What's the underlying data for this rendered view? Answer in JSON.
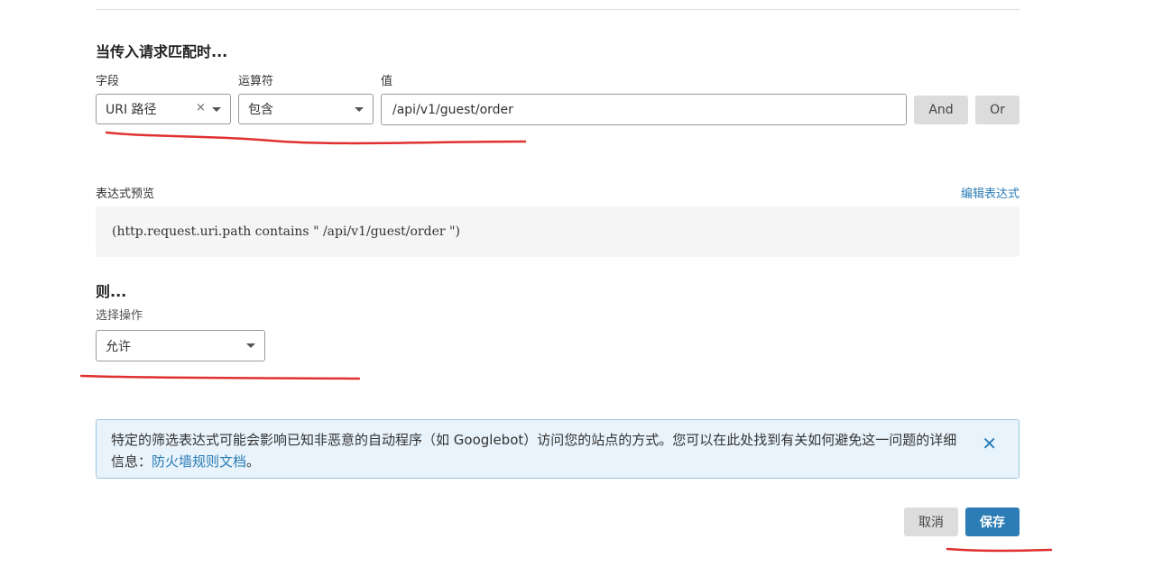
{
  "condition": {
    "heading": "当传入请求匹配时...",
    "field_label": "字段",
    "operator_label": "运算符",
    "value_label": "值",
    "field_value": "URI 路径",
    "clear_glyph": "×",
    "operator_value": "包含",
    "value_input": "/api/v1/guest/order",
    "and_label": "And",
    "or_label": "Or"
  },
  "preview": {
    "label": "表达式预览",
    "edit_link": "编辑表达式",
    "expression": "(http.request.uri.path contains \" /api/v1/guest/order \")"
  },
  "action": {
    "heading": "则...",
    "label": "选择操作",
    "value": "允许"
  },
  "alert": {
    "text": "特定的筛选表达式可能会影响已知非恶意的自动程序（如 Googlebot）访问您的站点的方式。您可以在此处找到有关如何避免这一问题的详细信息：",
    "link": "防火墙规则文档",
    "end": "。",
    "close_glyph": "✕"
  },
  "footer": {
    "cancel_label": "取消",
    "save_label": "保存"
  },
  "colors": {
    "accent": "#2c7cb6",
    "annotation_red": "#e03030"
  },
  "icons": [
    "caret-down-icon",
    "clear-icon",
    "close-icon"
  ]
}
